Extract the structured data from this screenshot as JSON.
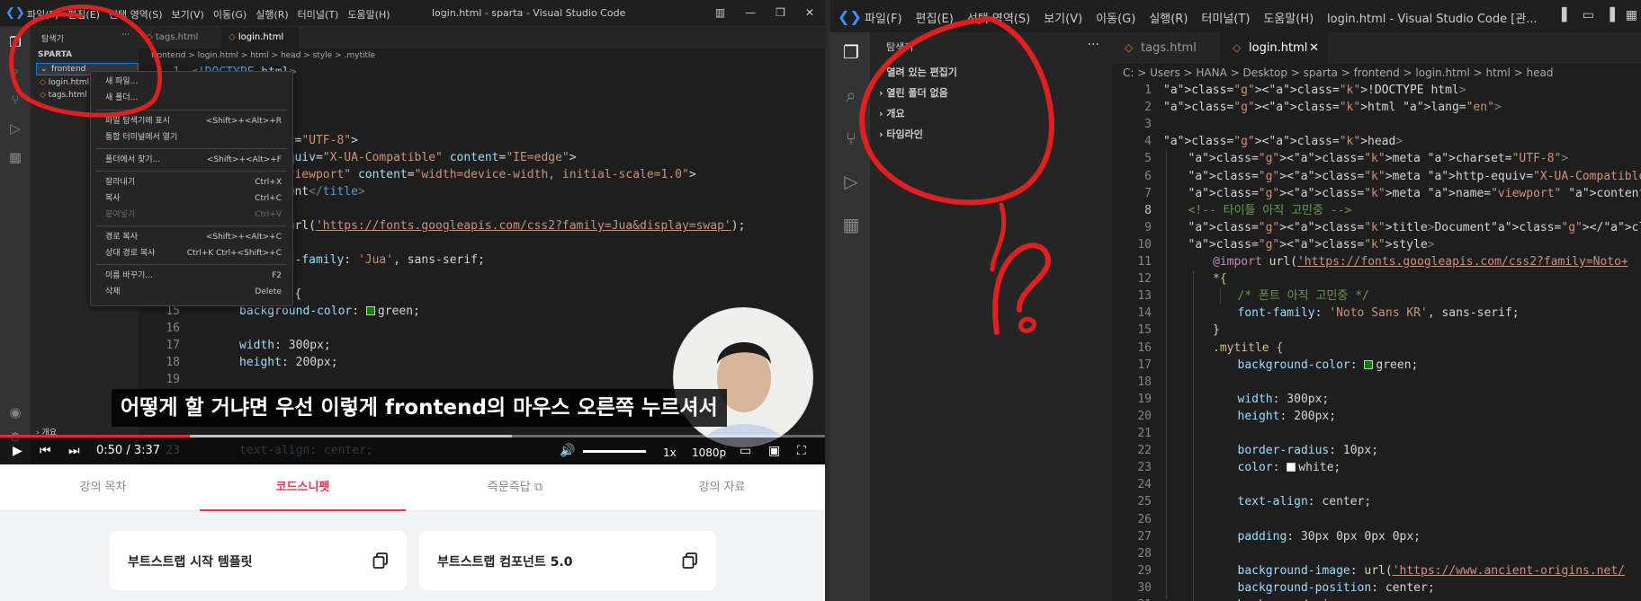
{
  "left_window": {
    "title": "login.html - sparta - Visual Studio Code",
    "menu": [
      "파일(F)",
      "편집(E)",
      "선택 영역(S)",
      "보기(V)",
      "이동(G)",
      "실행(R)",
      "터미널(T)",
      "도움말(H)"
    ],
    "explorer_label": "탐색기",
    "project": "SPARTA",
    "folder": "frontend",
    "files": [
      "login.html",
      "tags.html"
    ],
    "tabs": [
      "tags.html",
      "login.html"
    ],
    "breadcrumb": "frontend > login.html > html > head > style > .mytitle",
    "context_menu": [
      {
        "label": "새 파일...",
        "shortcut": ""
      },
      {
        "label": "새 폴더...",
        "shortcut": ""
      },
      {
        "label": "파일 탐색기에 표시",
        "shortcut": "<Shift>+<Alt>+R"
      },
      {
        "label": "통합 터미널에서 열기",
        "shortcut": ""
      },
      {
        "label": "폴더에서 찾기...",
        "shortcut": "<Shift>+<Alt>+F"
      },
      {
        "label": "잘라내기",
        "shortcut": "Ctrl+X"
      },
      {
        "label": "복사",
        "shortcut": "Ctrl+C"
      },
      {
        "label": "붙여넣기",
        "shortcut": "Ctrl+V"
      },
      {
        "label": "경로 복사",
        "shortcut": "<Shift>+<Alt>+C"
      },
      {
        "label": "상대 경로 복사",
        "shortcut": "Ctrl+K Ctrl+<Shift>+C"
      },
      {
        "label": "이름 바꾸기...",
        "shortcut": "F2"
      },
      {
        "label": "삭제",
        "shortcut": "Delete"
      }
    ],
    "outline_label": "개요"
  },
  "video": {
    "subtitle": "어떻게 할 거냐면 우선 이렇게 frontend의 마우스 오른쪽 누르셔서",
    "current_time": "0:50",
    "separator": "/",
    "duration": "3:37",
    "progress_fraction": 0.23,
    "speed": "1x",
    "quality": "1080p"
  },
  "course_tabs": [
    "강의 목차",
    "코드스니펫",
    "즉문즉답",
    "강의 자료"
  ],
  "snippets": [
    "부트스트랩 시작 템플릿",
    "부트스트랩 컴포넌트 5.0"
  ],
  "right_window": {
    "title": "login.html - Visual Studio Code [관...",
    "menu": [
      "파일(F)",
      "편집(E)",
      "선택 영역(S)",
      "보기(V)",
      "이동(G)",
      "실행(R)",
      "터미널(T)",
      "도움말(H)"
    ],
    "explorer_label": "탐색기",
    "explorer_sections": [
      "열려 있는 편집기",
      "열린 폴더 없음",
      "개요",
      "타임라인"
    ],
    "tabs": [
      "tags.html",
      "login.html"
    ],
    "breadcrumb": "C: > Users > HANA > Desktop > sparta > frontend > login.html > html > head",
    "current_line": 8,
    "code_lines": [
      "<!DOCTYPE html>",
      "<html lang=\"en\">",
      "",
      "<head>",
      "<meta charset=\"UTF-8\">",
      "<meta http-equiv=\"X-UA-Compatible\" content=\"IE=edge\">",
      "<meta name=\"viewport\" content=\"width=device-width, initial-scal",
      "<!-- 타이틀 아직 고민중 -->",
      "<title>Document</title>",
      "<style>",
      "@import url('https://fonts.googleapis.com/css2?family=Noto+",
      "*{",
      "/* 폰트 아직 고민중 */",
      "font-family: 'Noto Sans KR', sans-serif;",
      "}",
      ".mytitle {",
      "background-color: green;",
      "",
      "width: 300px;",
      "height: 200px;",
      "",
      "border-radius: 10px;",
      "color: white;",
      "",
      "text-align: center;",
      "",
      "padding: 30px 0px 0px 0px;",
      "",
      "background-image: url('https://www.ancient-origins.net/",
      "background-position: center;",
      "background-size: cover;"
    ]
  },
  "colors": {
    "accent": "#e8344e",
    "vscode_bg": "#1e1e1e",
    "annotation": "#e02020"
  },
  "icons": [
    "vscode-logo-icon",
    "explorer-icon",
    "search-icon",
    "source-control-icon",
    "run-debug-icon",
    "extensions-icon",
    "account-icon",
    "play-icon",
    "prev-icon",
    "next-icon",
    "volume-icon",
    "subtitles-icon",
    "pip-icon",
    "fullscreen-icon",
    "copy-icon",
    "external-link-icon"
  ]
}
